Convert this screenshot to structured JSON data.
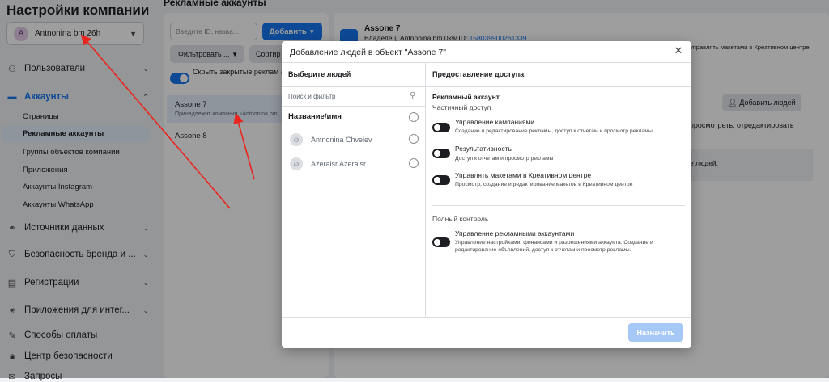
{
  "sidebar": {
    "title": "Настройки компании",
    "account": {
      "avatar_letter": "A",
      "name": "Antnonina bm 26h"
    },
    "items": [
      {
        "label": "Пользователи",
        "icon": "users-icon"
      },
      {
        "label": "Аккаунты",
        "icon": "briefcase-icon"
      },
      {
        "label": "Источники данных",
        "icon": "data-sources-icon"
      },
      {
        "label": "Безопасность бренда и ...",
        "icon": "shield-icon"
      },
      {
        "label": "Регистрации",
        "icon": "registrations-icon"
      },
      {
        "label": "Приложения для интег...",
        "icon": "integrations-icon"
      },
      {
        "label": "Способы оплаты",
        "icon": "payment-icon"
      },
      {
        "label": "Центр безопасности",
        "icon": "lock-icon"
      },
      {
        "label": "Запросы",
        "icon": "requests-icon"
      }
    ],
    "sub_items": [
      "Страницы",
      "Рекламные аккаунты",
      "Группы объектов компании",
      "Приложения",
      "Аккаунты Instagram",
      "Аккаунты WhatsApp"
    ]
  },
  "middle": {
    "header": "Рекламные аккаунты",
    "search_placeholder": "Введите ID, назва...",
    "add_label": "Добавить",
    "filter_label": "Фильтровать ...",
    "sort_label": "Сортир",
    "toggle_label": "Скрыть закрытые реклам аккаунты",
    "rows": [
      {
        "title": "Assone 7",
        "subtitle": "Принадлежит компании «Antnonina bm"
      },
      {
        "title": "Assone 8",
        "subtitle": ""
      }
    ]
  },
  "right_panel": {
    "title": "Assone 7",
    "owner_label": "Владелец: Antnonina bm 0kw  ID:",
    "owner_id": "158039900261339",
    "perm_text": "управлять макетами в Креативном центре",
    "add_people_label": "Добавить людей",
    "view_text": "просмотреть, отредактировать",
    "box_text": "е людей."
  },
  "modal": {
    "title": "Добавление людей в объект \"Assone 7\"",
    "left_header": "Выберите людей",
    "right_header": "Предоставление доступа",
    "search_placeholder": "Поиск и фильтр",
    "name_header": "Название/имя",
    "people": [
      "Antnonina Chvelev",
      "Azeraisr Azeraisr"
    ],
    "section_title": "Рекламный аккаунт",
    "partial_label": "Частичный доступ",
    "partial_perms": [
      {
        "title": "Управление кампаниями",
        "desc": "Создание и редактирование рекламы, доступ к отчетам и просмотр рекламы"
      },
      {
        "title": "Результативность",
        "desc": "Доступ к отчетам и просмотр рекламы"
      },
      {
        "title": "Управлять макетами в Креативном центре",
        "desc": "Просмотр, создание и редактирование макетов в Креативном центре"
      }
    ],
    "full_label": "Полный контроль",
    "full_perms": [
      {
        "title": "Управление рекламными аккаунтами",
        "desc": "Управление настройками, финансами и разрешениями аккаунта. Создание и редактирование объявлений, доступ к отчетам и просмотр рекламы."
      }
    ],
    "assign_label": "Назначить"
  },
  "colors": {
    "accent": "#1877f2",
    "arrow": "#e8261f",
    "disabled_btn": "#a6c8f7"
  }
}
